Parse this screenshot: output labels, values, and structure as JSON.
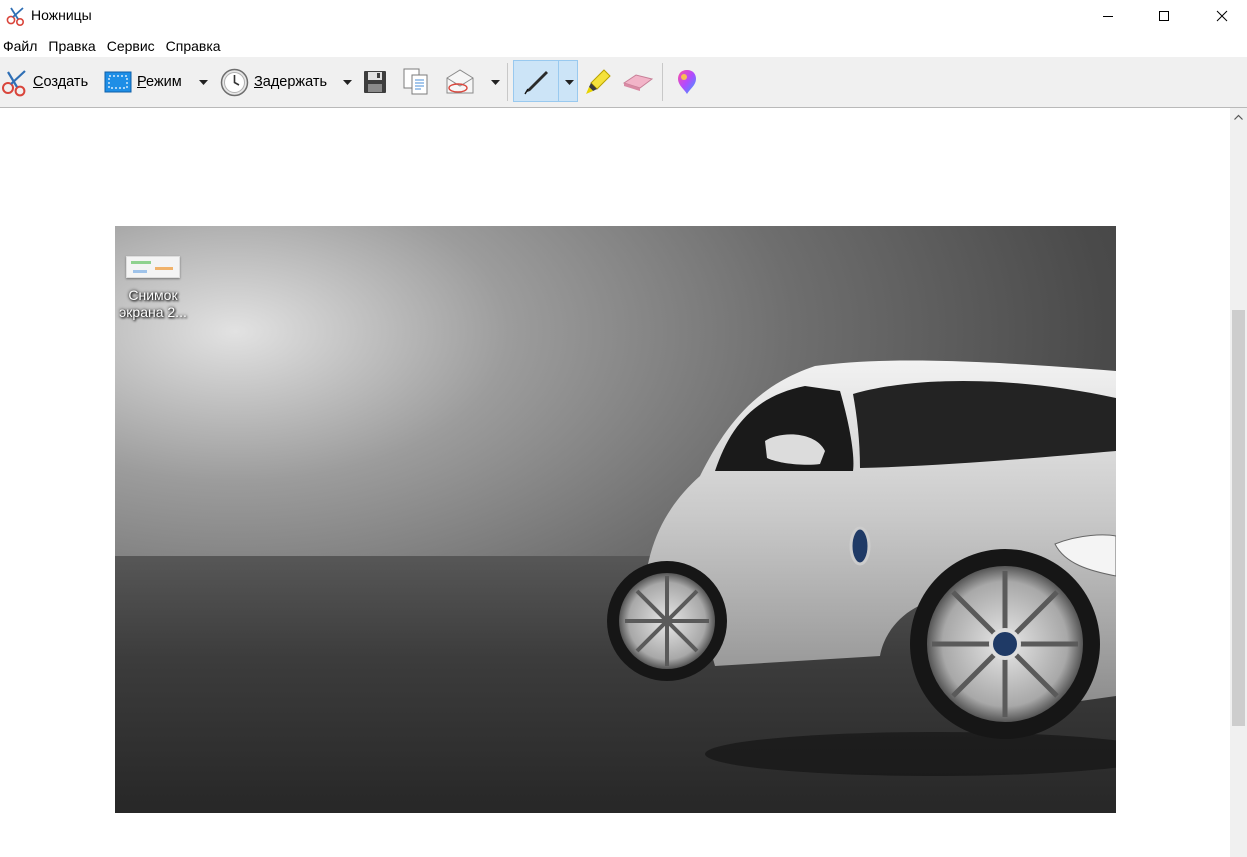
{
  "window": {
    "title": "Ножницы",
    "controls": [
      "minimize",
      "maximize",
      "close"
    ]
  },
  "menu": [
    "Файл",
    "Правка",
    "Сервис",
    "Справка"
  ],
  "toolbar": {
    "new_label_pre": "",
    "new_label_ul": "С",
    "new_label_post": "оздать",
    "mode_label_pre": "",
    "mode_label_ul": "Р",
    "mode_label_post": "ежим",
    "delay_label_pre": "",
    "delay_label_ul": "З",
    "delay_label_post": "адержать",
    "icons": [
      "scissors-icon",
      "rect-mode-icon",
      "clock-icon",
      "save-icon",
      "copy-icon",
      "send-email-icon",
      "pen-icon",
      "highlighter-icon",
      "eraser-icon",
      "paint3d-icon"
    ]
  },
  "capture": {
    "desktop_icon_label": "Снимок экрана 2..."
  },
  "colors": {
    "toolbar_bg": "#f0f0f0",
    "pen_selected_bg": "#cce4f7",
    "pen_selected_border": "#99c9ef"
  }
}
